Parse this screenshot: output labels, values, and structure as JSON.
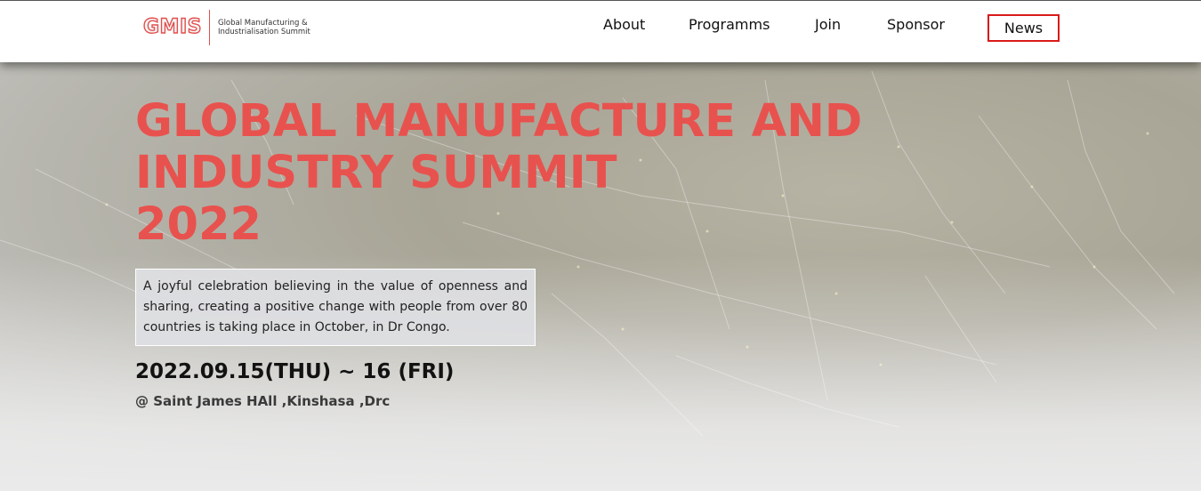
{
  "header": {
    "logo": {
      "mark": "GMIS",
      "subtitle": "Global Manufacturing &\nIndustrialisation Summit"
    },
    "nav": {
      "about": "About",
      "programms": "Programms",
      "join": "Join",
      "sponsor": "Sponsor",
      "news": "News"
    }
  },
  "hero": {
    "title_line1": "GLOBAL MANUFACTURE AND",
    "title_line2": "INDUSTRY SUMMIT",
    "title_line3": "2022",
    "description": "A joyful celebration believing in the value of openness and sharing, creating a positive change with people from over 80 countries is taking place in October, in Dr Congo.",
    "date": "2022.09.15(THU) ~ 16 (FRI)",
    "venue": "@ Saint James HAll ,Kinshasa ,Drc"
  },
  "colors": {
    "accent": "#e8524e",
    "highlight_border": "#d91a1a"
  }
}
